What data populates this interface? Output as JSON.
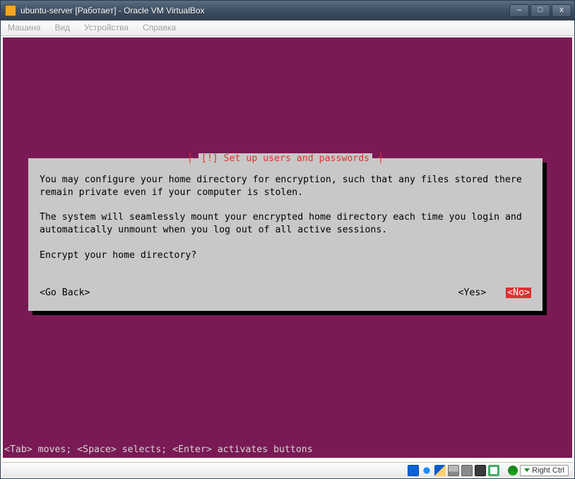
{
  "window": {
    "title": "ubuntu-server [Работает] - Oracle VM VirtualBox",
    "buttons": {
      "min": "–",
      "max": "□",
      "close": "x"
    }
  },
  "menubar": {
    "items": [
      "Машина",
      "Вид",
      "Устройства",
      "Справка"
    ]
  },
  "installer": {
    "dialog_title": "[!] Set up users and passwords",
    "para1": "You may configure your home directory for encryption, such that any files stored there remain private even if your computer is stolen.",
    "para2": "The system will seamlessly mount your encrypted home directory each time you login and automatically unmount when you log out of all active sessions.",
    "question": "Encrypt your home directory?",
    "go_back": "<Go Back>",
    "yes": "<Yes>",
    "no": "<No>",
    "hint": "<Tab> moves; <Space> selects; <Enter> activates buttons"
  },
  "statusbar": {
    "hostkey": "Right Ctrl"
  }
}
